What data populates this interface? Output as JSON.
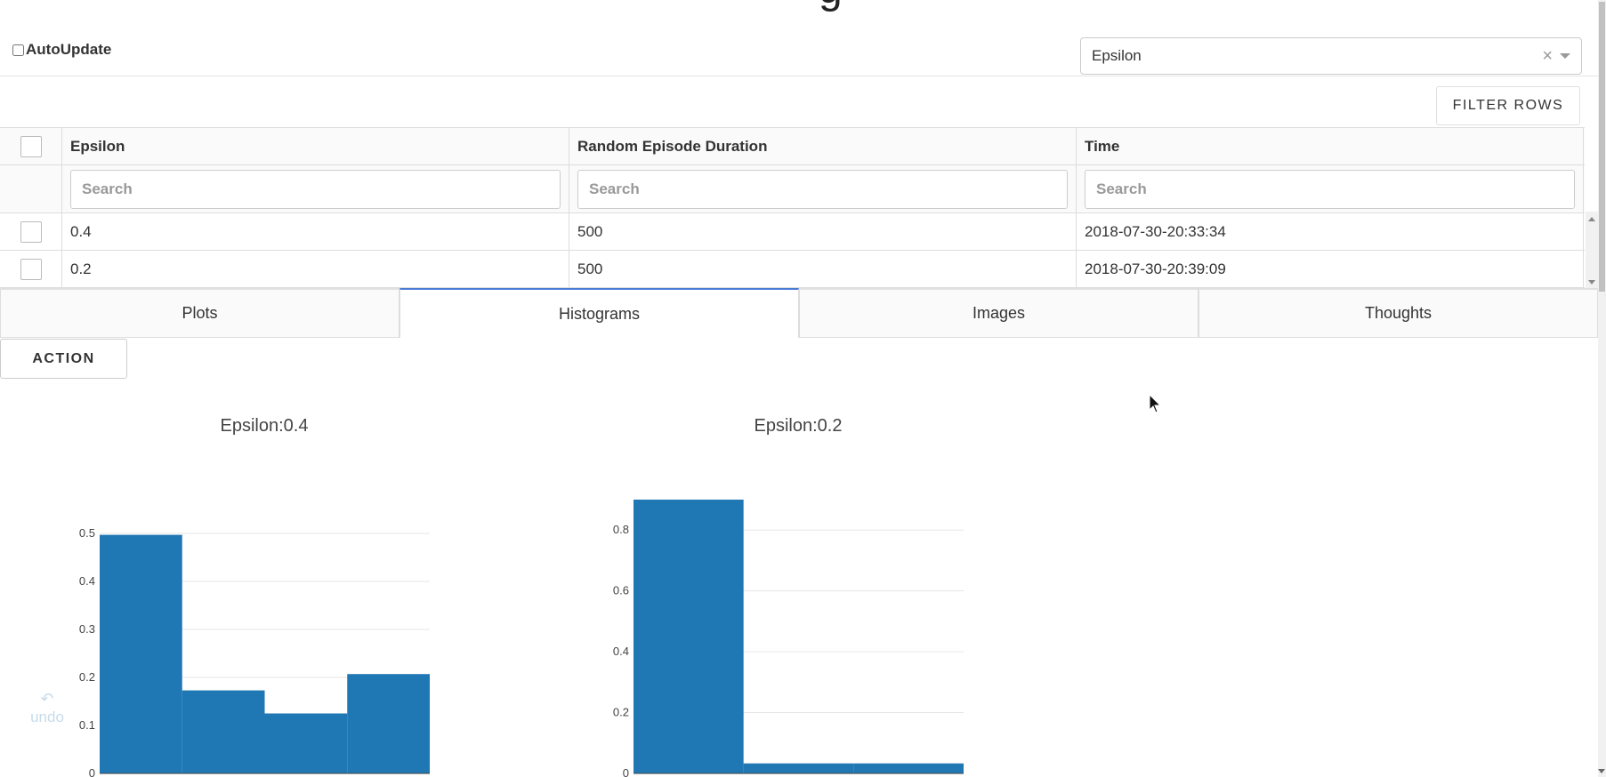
{
  "page": {
    "title_fragment": "g",
    "autoupdate_label": "AutoUpdate"
  },
  "column_select": {
    "value": "Epsilon",
    "clear_symbol": "×"
  },
  "filter_button": "FILTER ROWS",
  "table": {
    "headers": [
      "Epsilon",
      "Random Episode Duration",
      "Time"
    ],
    "search_placeholder": "Search",
    "rows": [
      {
        "epsilon": "0.4",
        "duration": "500",
        "time": "2018-07-30-20:33:34"
      },
      {
        "epsilon": "0.2",
        "duration": "500",
        "time": "2018-07-30-20:39:09"
      }
    ]
  },
  "tabs": [
    {
      "label": "Plots",
      "active": false
    },
    {
      "label": "Histograms",
      "active": true
    },
    {
      "label": "Images",
      "active": false
    },
    {
      "label": "Thoughts",
      "active": false
    }
  ],
  "action_button": "ACTION",
  "undo_label": "undo",
  "colors": {
    "bar": "#1f77b4",
    "active_tab_accent": "#4a7cd6"
  },
  "chart_data": [
    {
      "type": "bar",
      "title": "Epsilon:0.4",
      "values": [
        0.497,
        0.173,
        0.125,
        0.207
      ],
      "ylim": [
        0,
        0.5
      ],
      "yticks": [
        0,
        0.1,
        0.2,
        0.3,
        0.4,
        0.5
      ],
      "ytick_labels": [
        "0",
        "0.1",
        "0.2",
        "0.3",
        "0.4",
        "0.5"
      ],
      "grid": true
    },
    {
      "type": "bar",
      "title": "Epsilon:0.2",
      "values": [
        0.9,
        0.033,
        0.033
      ],
      "ylim": [
        0,
        0.9
      ],
      "yticks": [
        0,
        0.2,
        0.4,
        0.6,
        0.8
      ],
      "ytick_labels": [
        "0",
        "0.2",
        "0.4",
        "0.6",
        "0.8"
      ],
      "grid": true
    }
  ]
}
